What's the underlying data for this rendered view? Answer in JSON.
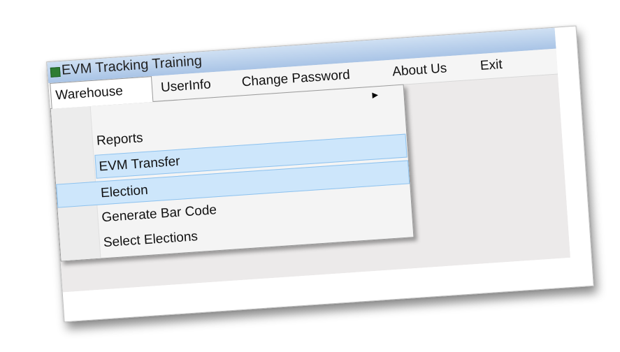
{
  "window": {
    "title": "EVM Tracking Training"
  },
  "menubar": {
    "items": [
      {
        "label": "Warehouse"
      },
      {
        "label": "UserInfo"
      },
      {
        "label": "Change Password"
      },
      {
        "label": "About Us"
      },
      {
        "label": "Exit"
      }
    ]
  },
  "warehouse_menu": {
    "items": [
      {
        "label": "Reports"
      },
      {
        "label": "EVM Transfer"
      },
      {
        "label": "Election"
      },
      {
        "label": "Generate Bar Code"
      },
      {
        "label": "Select Elections"
      }
    ]
  },
  "colors": {
    "highlight": "#cde6fb",
    "highlight_border": "#8ec2ee",
    "client_background": "#eceaea"
  }
}
